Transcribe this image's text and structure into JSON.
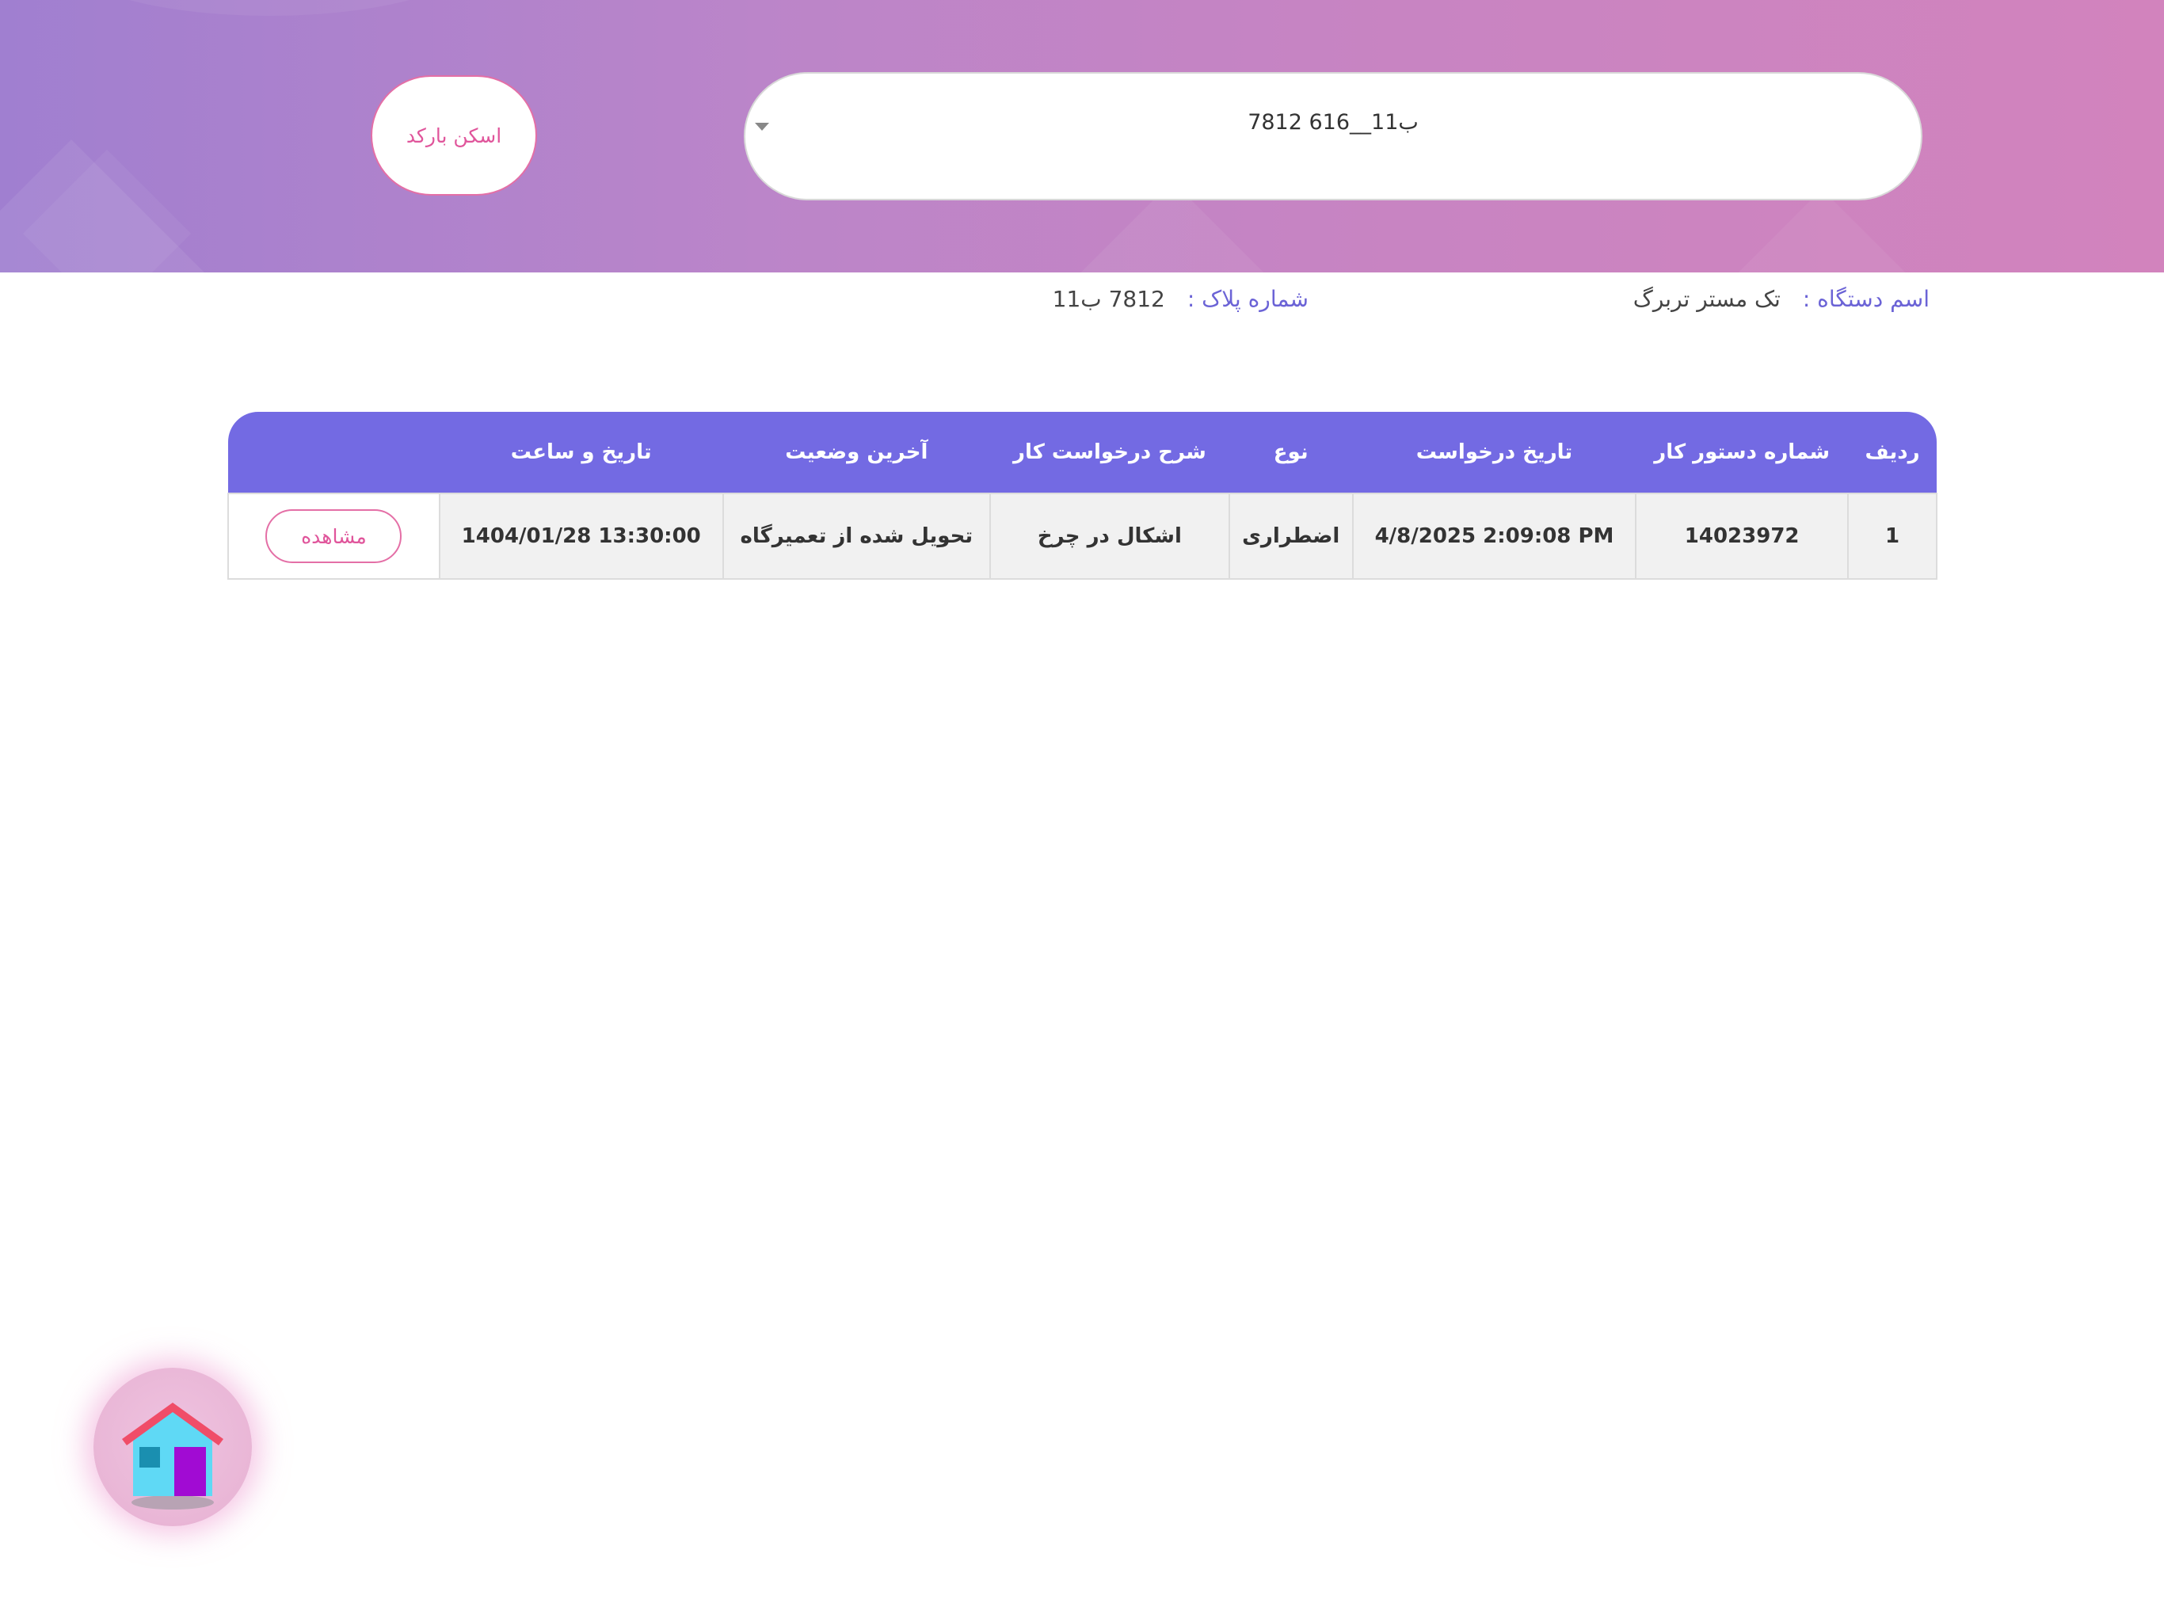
{
  "header": {
    "scan_button_label": "اسکن بارکد",
    "plate_select": {
      "selected_value": "7812 ب11__616"
    }
  },
  "device_info": {
    "device_name_label": "اسم دستگاه :",
    "device_name_value": "تک مستر تربرگ",
    "plate_number_label": "شماره پلاک :",
    "plate_number_value": "7812 ب11"
  },
  "table": {
    "headers": [
      "ردیف",
      "شماره دستور کار",
      "تاریخ درخواست",
      "نوع",
      "شرح درخواست کار",
      "آخرین وضعیت",
      "تاریخ و ساعت",
      ""
    ],
    "rows": [
      {
        "row_no": "1",
        "work_order_no": "14023972",
        "request_date": "4/8/2025 2:09:08 PM",
        "type": "اضطراری",
        "description": "اشکال در چرخ",
        "last_status": "تحویل شده از تعمیرگاه",
        "datetime": "1404/01/28 13:30:00",
        "action_label": "مشاهده"
      }
    ]
  },
  "home_button": {
    "icon": "house-icon"
  },
  "colors": {
    "header_gradient_start": "#a07fd0",
    "header_gradient_end": "#d283bd",
    "accent_pink": "#e0559b",
    "table_header_purple": "#736ae3",
    "label_purple": "#6b63d6"
  }
}
